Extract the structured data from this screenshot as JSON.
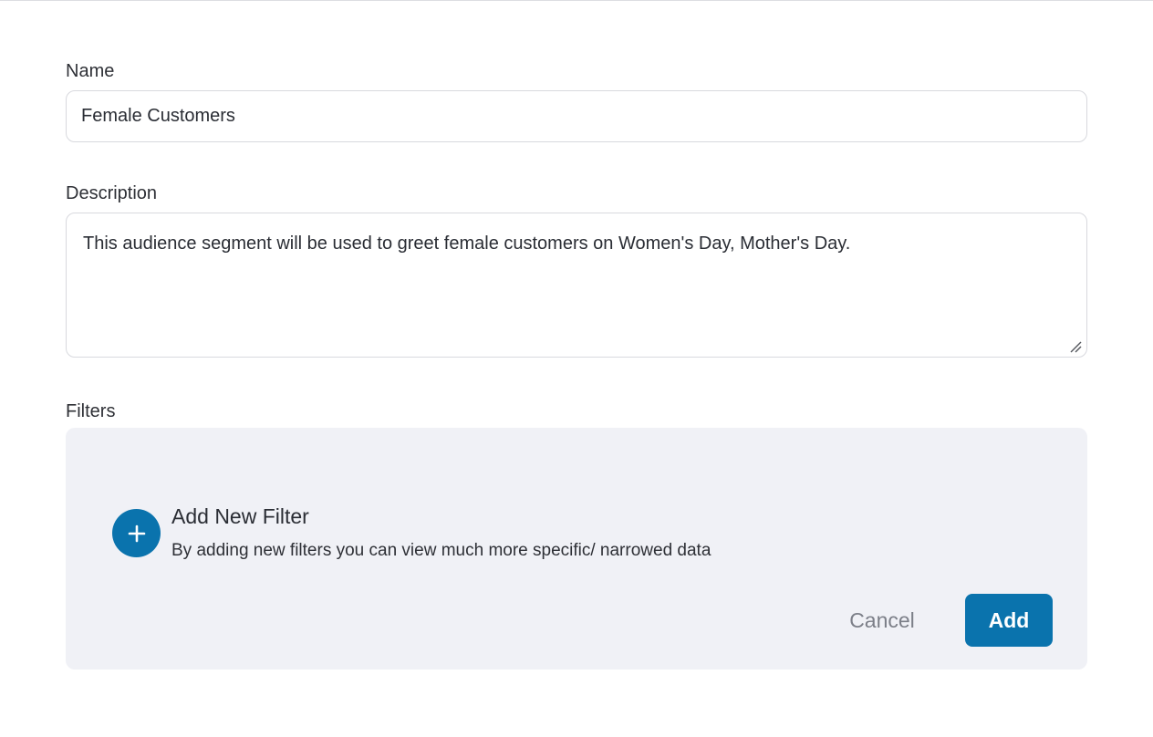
{
  "name_field": {
    "label": "Name",
    "value": "Female Customers"
  },
  "description_field": {
    "label": "Description",
    "value": "This audience segment will be used to greet female customers on Women's Day, Mother's Day."
  },
  "filters": {
    "label": "Filters",
    "add_title": "Add New Filter",
    "add_subtitle": "By adding new filters you can view much more specific/ narrowed data",
    "cancel_label": "Cancel",
    "add_label": "Add",
    "accent_color": "#0a73ad",
    "panel_color": "#f0f1f6",
    "icons": {
      "add_filter": "plus-icon",
      "resize": "resize-handle-icon"
    }
  }
}
